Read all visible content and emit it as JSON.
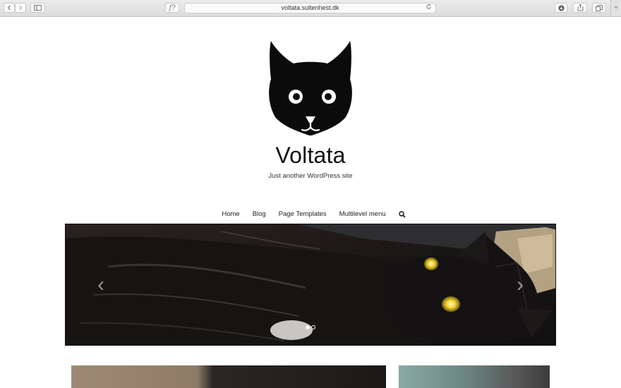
{
  "browser": {
    "url": "voltata.sultenhest.dk",
    "reader_label": "f?",
    "new_tab_glyph": "+"
  },
  "header": {
    "logo_icon": "black-cat-head-icon",
    "title": "Voltata",
    "tagline": "Just another WordPress site"
  },
  "nav": {
    "items": [
      {
        "label": "Home"
      },
      {
        "label": "Blog"
      },
      {
        "label": "Page Templates"
      },
      {
        "label": "Multilevel menu"
      }
    ],
    "search_icon": "search-icon"
  },
  "slider": {
    "prev_glyph": "‹",
    "next_glyph": "›",
    "slide_count": 2,
    "active_slide": 1
  },
  "colors": {
    "accent": "#111111",
    "chrome": "#e0e0e0"
  }
}
